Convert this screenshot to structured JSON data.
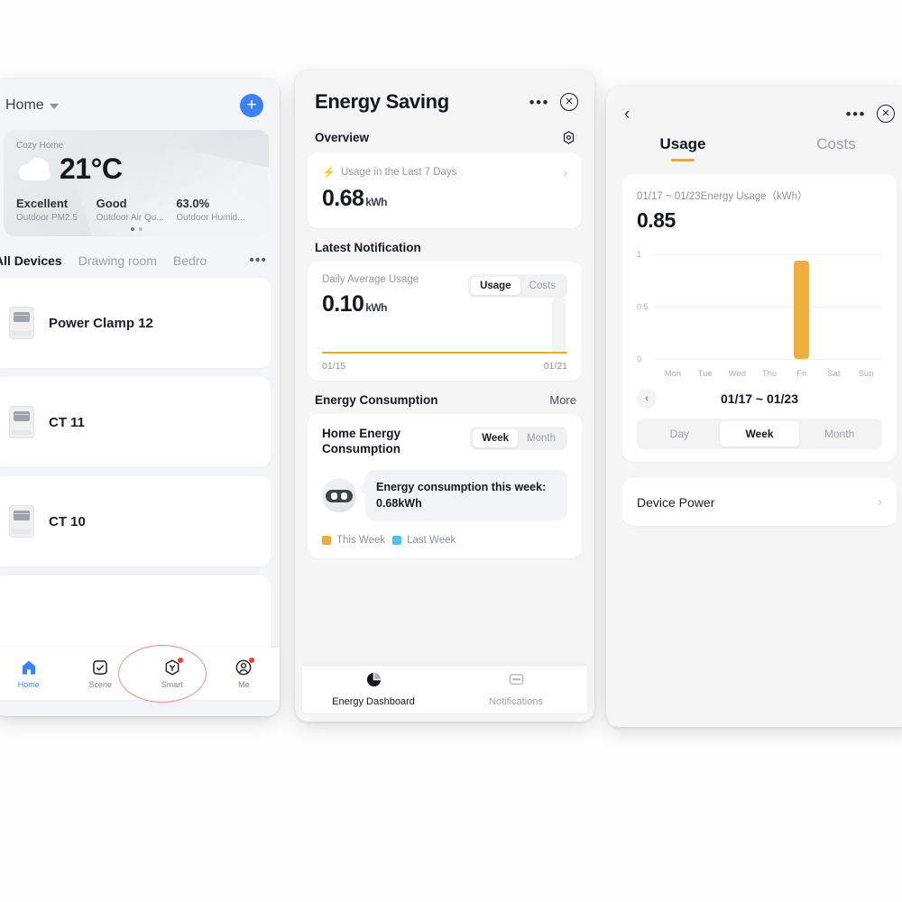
{
  "home": {
    "title": "Home",
    "add_label": "+",
    "weather": {
      "place": "Cozy Home",
      "temperature": "21°C",
      "stats": [
        {
          "value": "Excellent",
          "label": "Outdoor PM2.5"
        },
        {
          "value": "Good",
          "label": "Outdoor Air Qu..."
        },
        {
          "value": "63.0%",
          "label": "Outdoor Humid..."
        }
      ]
    },
    "room_tabs": [
      "All Devices",
      "Drawing room",
      "Bedro"
    ],
    "room_more": "•••",
    "devices": [
      {
        "name": "Power Clamp 12"
      },
      {
        "name": "CT 11"
      },
      {
        "name": "CT 10"
      }
    ],
    "tabbar": [
      {
        "label": "Home",
        "icon": "home-icon",
        "active": true,
        "badge": false
      },
      {
        "label": "Scene",
        "icon": "scene-icon",
        "active": false,
        "badge": false
      },
      {
        "label": "Smart",
        "icon": "smart-icon",
        "active": false,
        "badge": true
      },
      {
        "label": "Me",
        "icon": "profile-icon",
        "active": false,
        "badge": true
      }
    ]
  },
  "energy": {
    "title": "Energy Saving",
    "more_dots": "•••",
    "close": "✕",
    "overview_label": "Overview",
    "usage7": {
      "bolt": "⚡",
      "label": "Usage in the Last 7 Days",
      "value": "0.68",
      "unit": "kWh",
      "chevron": "›"
    },
    "notification_label": "Latest Notification",
    "notification": {
      "label": "Daily Average Usage",
      "value": "0.10",
      "unit": "kWh",
      "toggle": [
        "Usage",
        "Costs"
      ],
      "toggle_selected": "Usage",
      "x_start": "01/15",
      "x_end": "01/21"
    },
    "consumption_label": "Energy Consumption",
    "consumption_more": "More",
    "consumption": {
      "card_title": "Home Energy Consumption",
      "period_options": [
        "Week",
        "Month"
      ],
      "period_selected": "Week",
      "bubble_text": "Energy consumption this week: 0.68kWh",
      "legend": [
        {
          "name": "This Week",
          "color": "#efa93c"
        },
        {
          "name": "Last Week",
          "color": "#4ec3e8"
        }
      ]
    },
    "tabbar": [
      {
        "label": "Energy Dashboard",
        "icon": "pie-chart-icon",
        "active": true
      },
      {
        "label": "Notifications",
        "icon": "chat-bubble-icon",
        "active": false
      }
    ]
  },
  "usage": {
    "back": "‹",
    "more_dots": "•••",
    "close": "✕",
    "tabs": [
      "Usage",
      "Costs"
    ],
    "tab_selected": "Usage",
    "card_label": "01/17 ~ 01/23Energy Usage（kWh）",
    "card_value": "0.85",
    "date_range": "01/17 ~ 01/23",
    "prev_arrow": "‹",
    "period_options": [
      "Day",
      "Week",
      "Month"
    ],
    "period_selected": "Week",
    "device_power_label": "Device Power",
    "device_power_chevron": "›"
  },
  "chart_data": {
    "type": "bar",
    "title": "01/17 ~ 01/23Energy Usage（kWh）",
    "categories": [
      "Mon",
      "Tue",
      "Wed",
      "Thu",
      "Fri",
      "Sat",
      "Sun"
    ],
    "values": [
      0,
      0,
      0,
      0,
      0.85,
      0,
      0
    ],
    "ylim": [
      0,
      1
    ],
    "yticks": [
      "0",
      "0.5",
      "1"
    ],
    "ylabel": "kWh",
    "xlabel": "",
    "bar_color": "#eeae42",
    "grid": true,
    "legend": "none"
  }
}
